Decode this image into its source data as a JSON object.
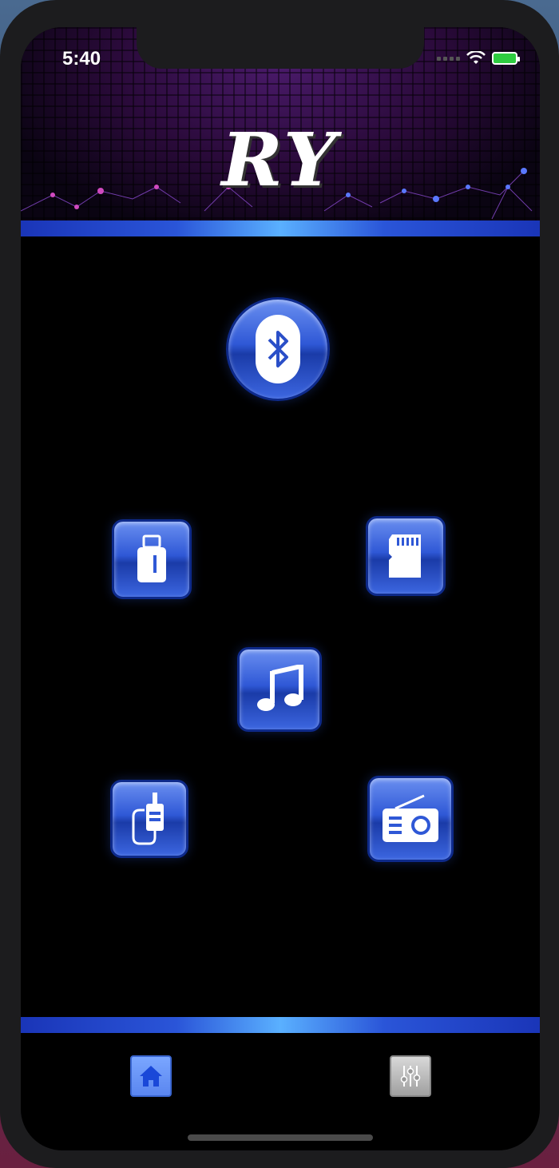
{
  "status": {
    "time": "5:40"
  },
  "header": {
    "logo_text": "RY"
  },
  "sources": [
    {
      "name": "bluetooth",
      "icon": "bluetooth-icon"
    },
    {
      "name": "usb",
      "icon": "usb-drive-icon"
    },
    {
      "name": "sd-card",
      "icon": "sd-card-icon"
    },
    {
      "name": "music",
      "icon": "music-note-icon"
    },
    {
      "name": "aux",
      "icon": "aux-cable-icon"
    },
    {
      "name": "radio",
      "icon": "radio-icon"
    }
  ],
  "tabbar": {
    "items": [
      {
        "name": "home",
        "icon": "home-icon",
        "active": true
      },
      {
        "name": "equalizer",
        "icon": "equalizer-sliders-icon",
        "active": false
      }
    ]
  },
  "colors": {
    "accent": "#2f58d6",
    "bar_highlight": "#5ab0ff",
    "active_tab": "#6a96ff"
  }
}
